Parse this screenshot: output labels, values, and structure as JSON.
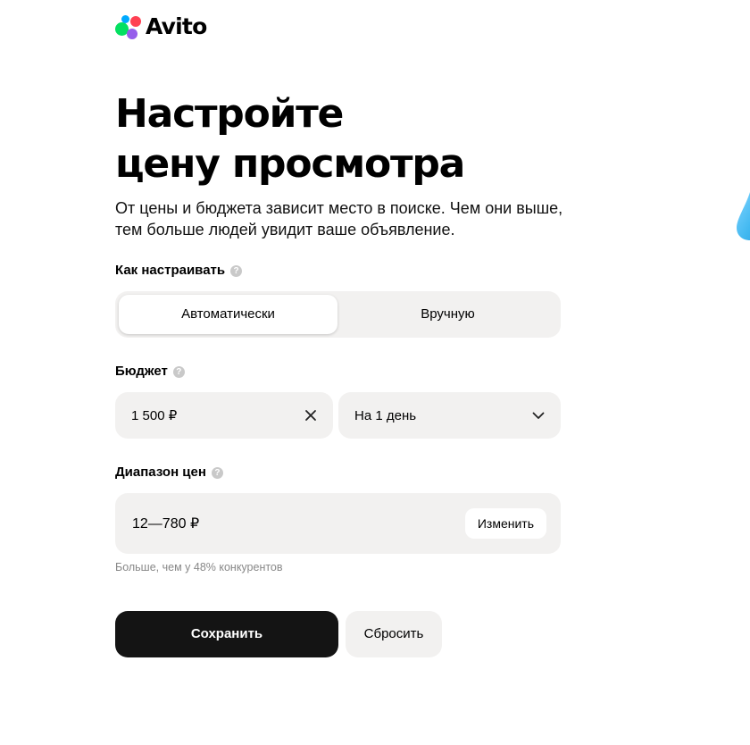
{
  "brand": {
    "name": "Avito",
    "dot_colors": [
      "#04e061",
      "#965eeb",
      "#00aaff",
      "#ff4053"
    ]
  },
  "title": {
    "line1": "Настройте",
    "line2": "цену просмотра"
  },
  "subtitle": "От цены и бюджета зависит место в поиске. Чем они выше, тем больше людей увидит ваше объявление.",
  "mode": {
    "label": "Как настраивать",
    "help_icon": "question-circle-icon",
    "options": [
      "Автоматически",
      "Вручную"
    ],
    "selected": "Автоматически"
  },
  "budget": {
    "label": "Бюджет",
    "help_icon": "question-circle-icon",
    "value": "1 500 ₽",
    "clear_icon": "close-icon",
    "period": "На 1 день",
    "period_icon": "chevron-down-icon"
  },
  "price_range": {
    "label": "Диапазон цен",
    "help_icon": "question-circle-icon",
    "value": "12—780 ₽",
    "change_label": "Изменить",
    "hint": "Больше, чем у 48% конкурентов"
  },
  "actions": {
    "save": "Сохранить",
    "reset": "Сбросить"
  },
  "colors": {
    "field_bg": "#f2f1f0",
    "primary_button": "#141414",
    "accent_drop": "#41b8f0"
  }
}
